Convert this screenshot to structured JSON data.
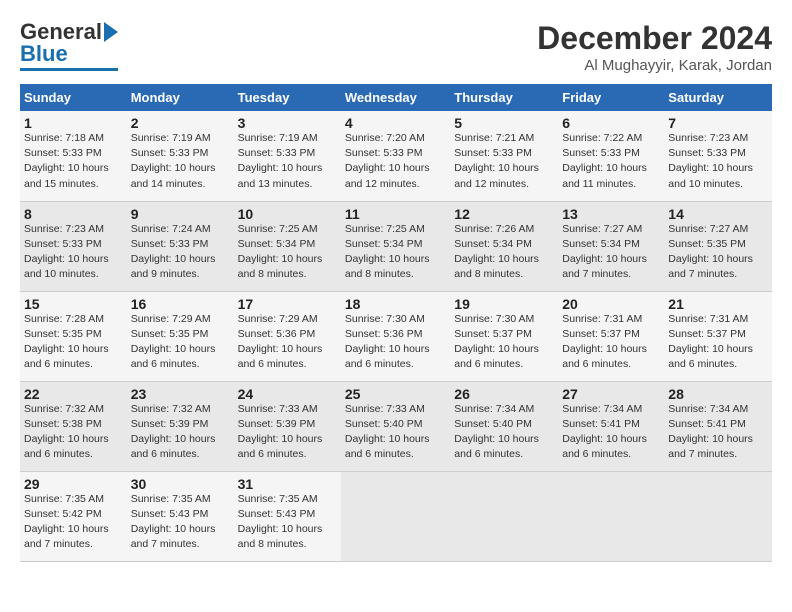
{
  "header": {
    "logo_general": "General",
    "logo_blue": "Blue",
    "month_title": "December 2024",
    "location": "Al Mughayyir, Karak, Jordan"
  },
  "days_of_week": [
    "Sunday",
    "Monday",
    "Tuesday",
    "Wednesday",
    "Thursday",
    "Friday",
    "Saturday"
  ],
  "weeks": [
    [
      {
        "day": 1,
        "info": "Sunrise: 7:18 AM\nSunset: 5:33 PM\nDaylight: 10 hours\nand 15 minutes."
      },
      {
        "day": 2,
        "info": "Sunrise: 7:19 AM\nSunset: 5:33 PM\nDaylight: 10 hours\nand 14 minutes."
      },
      {
        "day": 3,
        "info": "Sunrise: 7:19 AM\nSunset: 5:33 PM\nDaylight: 10 hours\nand 13 minutes."
      },
      {
        "day": 4,
        "info": "Sunrise: 7:20 AM\nSunset: 5:33 PM\nDaylight: 10 hours\nand 12 minutes."
      },
      {
        "day": 5,
        "info": "Sunrise: 7:21 AM\nSunset: 5:33 PM\nDaylight: 10 hours\nand 12 minutes."
      },
      {
        "day": 6,
        "info": "Sunrise: 7:22 AM\nSunset: 5:33 PM\nDaylight: 10 hours\nand 11 minutes."
      },
      {
        "day": 7,
        "info": "Sunrise: 7:23 AM\nSunset: 5:33 PM\nDaylight: 10 hours\nand 10 minutes."
      }
    ],
    [
      {
        "day": 8,
        "info": "Sunrise: 7:23 AM\nSunset: 5:33 PM\nDaylight: 10 hours\nand 10 minutes."
      },
      {
        "day": 9,
        "info": "Sunrise: 7:24 AM\nSunset: 5:33 PM\nDaylight: 10 hours\nand 9 minutes."
      },
      {
        "day": 10,
        "info": "Sunrise: 7:25 AM\nSunset: 5:34 PM\nDaylight: 10 hours\nand 8 minutes."
      },
      {
        "day": 11,
        "info": "Sunrise: 7:25 AM\nSunset: 5:34 PM\nDaylight: 10 hours\nand 8 minutes."
      },
      {
        "day": 12,
        "info": "Sunrise: 7:26 AM\nSunset: 5:34 PM\nDaylight: 10 hours\nand 8 minutes."
      },
      {
        "day": 13,
        "info": "Sunrise: 7:27 AM\nSunset: 5:34 PM\nDaylight: 10 hours\nand 7 minutes."
      },
      {
        "day": 14,
        "info": "Sunrise: 7:27 AM\nSunset: 5:35 PM\nDaylight: 10 hours\nand 7 minutes."
      }
    ],
    [
      {
        "day": 15,
        "info": "Sunrise: 7:28 AM\nSunset: 5:35 PM\nDaylight: 10 hours\nand 6 minutes."
      },
      {
        "day": 16,
        "info": "Sunrise: 7:29 AM\nSunset: 5:35 PM\nDaylight: 10 hours\nand 6 minutes."
      },
      {
        "day": 17,
        "info": "Sunrise: 7:29 AM\nSunset: 5:36 PM\nDaylight: 10 hours\nand 6 minutes."
      },
      {
        "day": 18,
        "info": "Sunrise: 7:30 AM\nSunset: 5:36 PM\nDaylight: 10 hours\nand 6 minutes."
      },
      {
        "day": 19,
        "info": "Sunrise: 7:30 AM\nSunset: 5:37 PM\nDaylight: 10 hours\nand 6 minutes."
      },
      {
        "day": 20,
        "info": "Sunrise: 7:31 AM\nSunset: 5:37 PM\nDaylight: 10 hours\nand 6 minutes."
      },
      {
        "day": 21,
        "info": "Sunrise: 7:31 AM\nSunset: 5:37 PM\nDaylight: 10 hours\nand 6 minutes."
      }
    ],
    [
      {
        "day": 22,
        "info": "Sunrise: 7:32 AM\nSunset: 5:38 PM\nDaylight: 10 hours\nand 6 minutes."
      },
      {
        "day": 23,
        "info": "Sunrise: 7:32 AM\nSunset: 5:39 PM\nDaylight: 10 hours\nand 6 minutes."
      },
      {
        "day": 24,
        "info": "Sunrise: 7:33 AM\nSunset: 5:39 PM\nDaylight: 10 hours\nand 6 minutes."
      },
      {
        "day": 25,
        "info": "Sunrise: 7:33 AM\nSunset: 5:40 PM\nDaylight: 10 hours\nand 6 minutes."
      },
      {
        "day": 26,
        "info": "Sunrise: 7:34 AM\nSunset: 5:40 PM\nDaylight: 10 hours\nand 6 minutes."
      },
      {
        "day": 27,
        "info": "Sunrise: 7:34 AM\nSunset: 5:41 PM\nDaylight: 10 hours\nand 6 minutes."
      },
      {
        "day": 28,
        "info": "Sunrise: 7:34 AM\nSunset: 5:41 PM\nDaylight: 10 hours\nand 7 minutes."
      }
    ],
    [
      {
        "day": 29,
        "info": "Sunrise: 7:35 AM\nSunset: 5:42 PM\nDaylight: 10 hours\nand 7 minutes."
      },
      {
        "day": 30,
        "info": "Sunrise: 7:35 AM\nSunset: 5:43 PM\nDaylight: 10 hours\nand 7 minutes."
      },
      {
        "day": 31,
        "info": "Sunrise: 7:35 AM\nSunset: 5:43 PM\nDaylight: 10 hours\nand 8 minutes."
      },
      null,
      null,
      null,
      null
    ]
  ]
}
